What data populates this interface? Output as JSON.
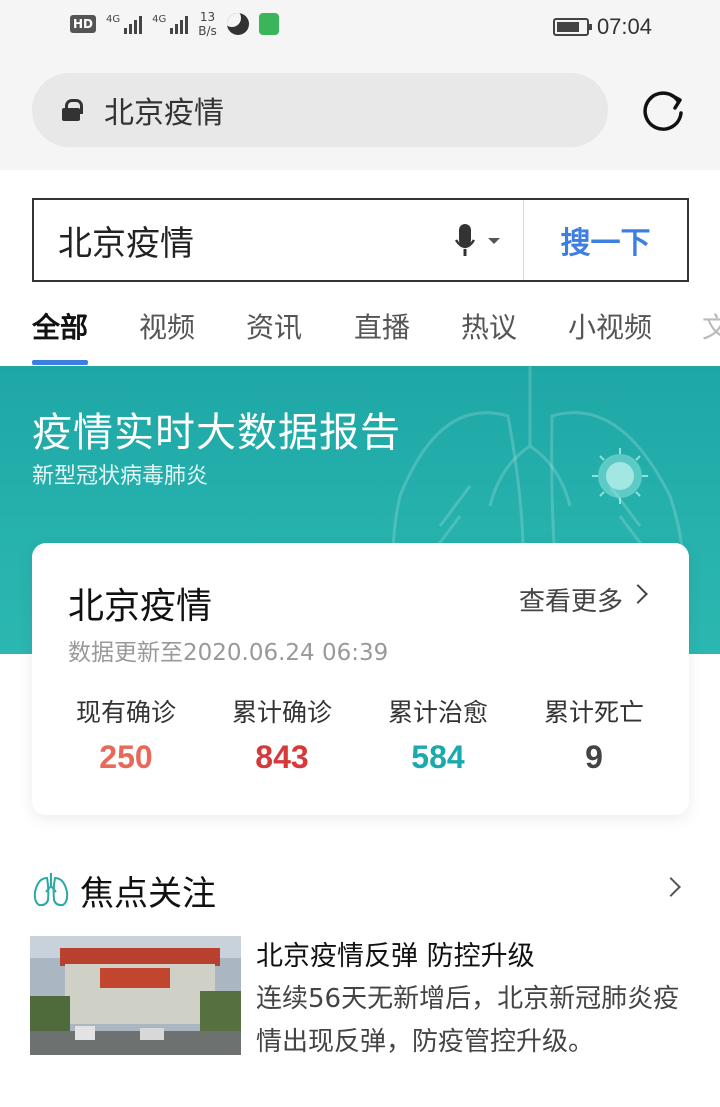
{
  "status_bar": {
    "hd": "HD",
    "signal1": "4G",
    "signal2": "4G",
    "speed_value": "13",
    "speed_unit": "B/s",
    "time": "07:04"
  },
  "address_bar": {
    "text": "北京疫情"
  },
  "search": {
    "value": "北京疫情",
    "button_label": "搜一下"
  },
  "tabs": [
    {
      "label": "全部",
      "active": true
    },
    {
      "label": "视频"
    },
    {
      "label": "资讯"
    },
    {
      "label": "直播"
    },
    {
      "label": "热议"
    },
    {
      "label": "小视频"
    },
    {
      "label": "文"
    }
  ],
  "banner": {
    "title": "疫情实时大数据报告",
    "subtitle": "新型冠状病毒肺炎"
  },
  "card": {
    "title": "北京疫情",
    "more_label": "查看更多",
    "update_text": "数据更新至2020.06.24 06:39",
    "stats": [
      {
        "label": "现有确诊",
        "value": "250",
        "color": "#e8685a"
      },
      {
        "label": "累计确诊",
        "value": "843",
        "color": "#d6393a"
      },
      {
        "label": "累计治愈",
        "value": "584",
        "color": "#1aa9ad"
      },
      {
        "label": "累计死亡",
        "value": "9",
        "color": "#444444"
      }
    ]
  },
  "focus": {
    "title": "焦点关注",
    "news": {
      "title": "北京疫情反弹 防控升级",
      "description": "连续56天无新增后，北京新冠肺炎疫情出现反弹，防疫管控升级。"
    }
  },
  "colors": {
    "accent": "#3d7fe0",
    "banner": "#22acaa"
  }
}
